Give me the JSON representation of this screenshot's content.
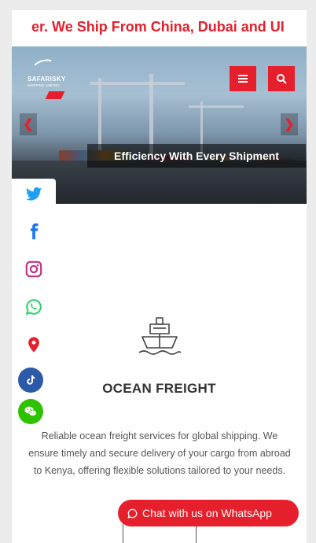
{
  "marquee": {
    "text": "er. We Ship From China, Dubai and UI"
  },
  "header": {
    "logo_name": "SAFARISKY",
    "logo_sub": "SHIPPING LIMITED",
    "menu_icon": "bars-icon",
    "search_icon": "search-icon"
  },
  "slider": {
    "prev_label": "❮",
    "next_label": "❯",
    "caption": "Efficiency With Every Shipment"
  },
  "social": {
    "items": [
      "twitter-icon",
      "facebook-icon",
      "instagram-icon",
      "whatsapp-icon",
      "map-marker-icon",
      "tiktok-icon",
      "wechat-icon"
    ]
  },
  "service": {
    "icon": "ship-icon",
    "title": "OCEAN FREIGHT",
    "description": "Reliable ocean freight services for global shipping. We ensure timely and secure delivery of your cargo from abroad to Kenya, offering flexible solutions tailored to your needs."
  },
  "chat": {
    "label": "Chat with us on WhatsApp"
  },
  "colors": {
    "accent": "#e5202c",
    "twitter": "#1da1f2",
    "facebook": "#1877f2",
    "instagram": "#c13584",
    "whatsapp": "#25d366",
    "wechat": "#2dc100",
    "tiktok": "#2d5aa8"
  }
}
